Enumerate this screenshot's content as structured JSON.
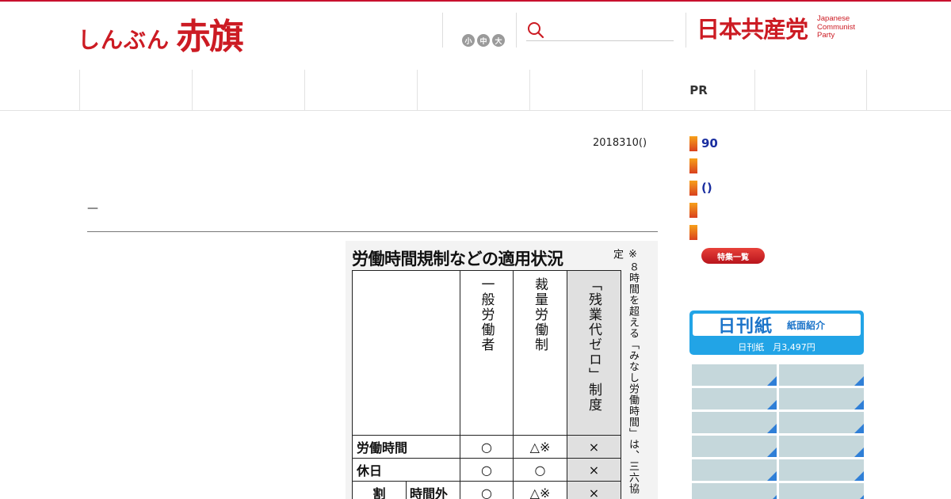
{
  "header": {
    "logo_small": "しんぶん",
    "logo_big": "赤旗",
    "font_sizes": [
      "小",
      "中",
      "大"
    ],
    "search_placeholder": "",
    "party_jp": "日本共産党",
    "party_en": [
      "Japanese",
      "Communist",
      "Party"
    ]
  },
  "nav": {
    "items": [
      "",
      "",
      "",
      "",
      "",
      "PR",
      ""
    ]
  },
  "article": {
    "date": "2018310()",
    "headline": "—"
  },
  "figure": {
    "title": "労働時間規制などの適用状況",
    "note": "※８時間を超える「みなし労働時間」は、三六協定",
    "columns": [
      "",
      "一般労働者",
      "裁量労働制",
      "「残業代ゼロ」制度"
    ],
    "rows": [
      {
        "label": "労働時間",
        "cells": [
          "○",
          "△※",
          "×"
        ]
      },
      {
        "label": "休日",
        "cells": [
          "○",
          "○",
          "×"
        ]
      },
      {
        "label": "割",
        "sublabel": "時間外",
        "cells": [
          "○",
          "△※",
          "×"
        ]
      }
    ]
  },
  "sidebar": {
    "items": [
      "90",
      "",
      "()",
      "",
      ""
    ],
    "tokushu_label": "特集一覧",
    "banner": {
      "main": "日刊紙",
      "sub": "紙面紹介",
      "price": "日刊紙　月3,497円"
    }
  },
  "colors": {
    "brand_red": "#cc1b23",
    "link_blue": "#1a2ea0",
    "banner_blue": "#22a4e6"
  }
}
